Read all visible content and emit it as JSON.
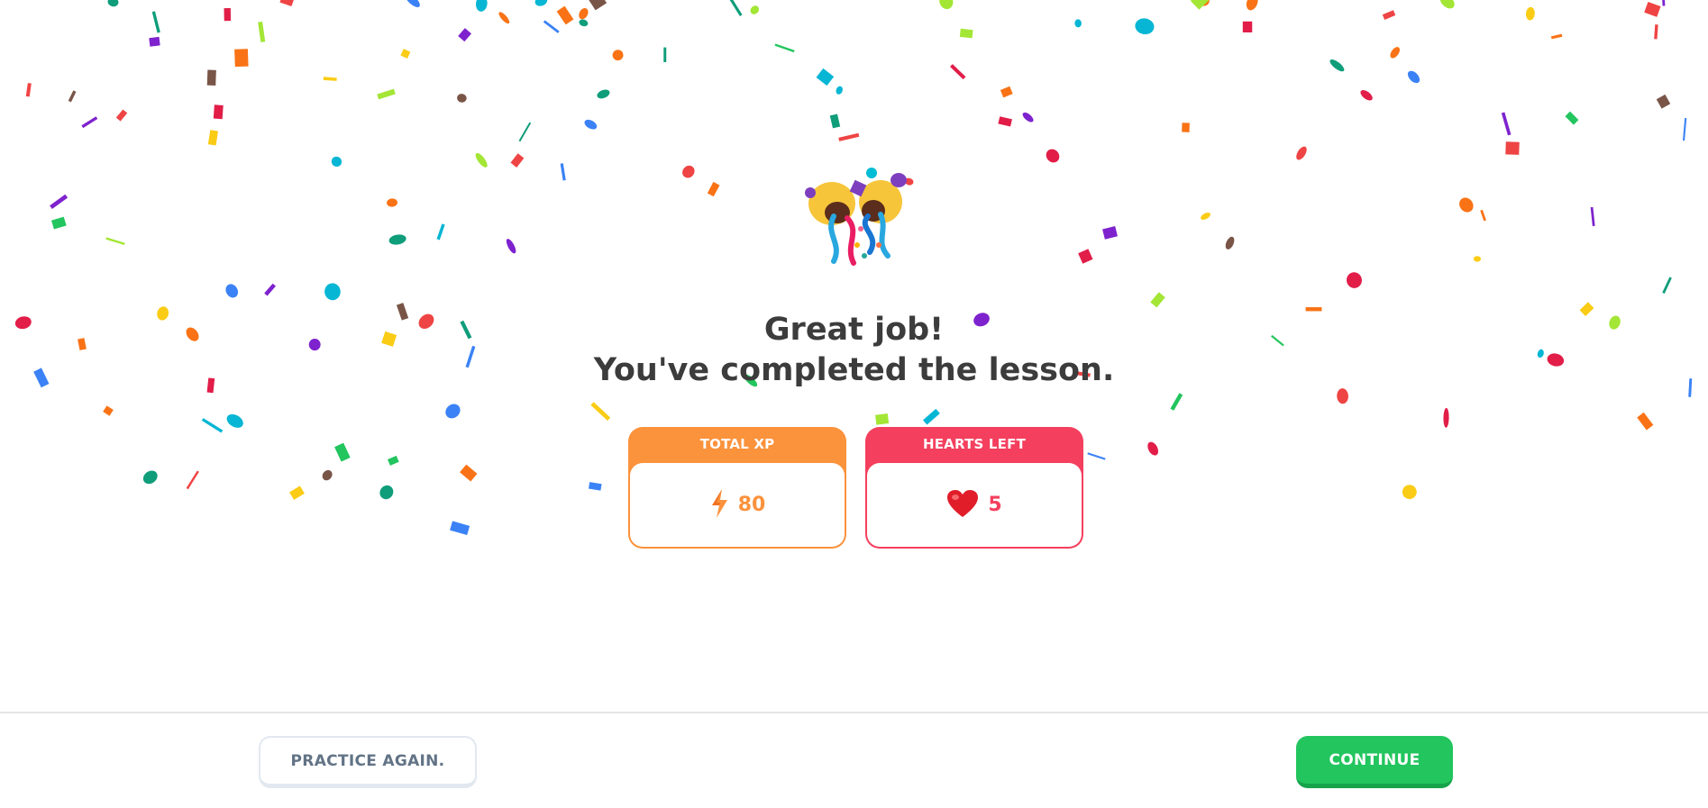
{
  "celebration": {
    "emoji_icon": "party-popper-icon",
    "headline_line1": "Great job!",
    "headline_line2": "You've completed the lesson."
  },
  "stats": {
    "xp": {
      "label": "TOTAL XP",
      "value": "80",
      "icon": "lightning-bolt-icon",
      "color": "#fb923c"
    },
    "hearts": {
      "label": "HEARTS LEFT",
      "value": "5",
      "icon": "heart-icon",
      "color": "#f43f5e"
    }
  },
  "footer": {
    "practice_label": "PRACTICE AGAIN.",
    "continue_label": "CONTINUE",
    "continue_color": "#22c55e"
  },
  "confetti_palette": [
    "#ef4444",
    "#f97316",
    "#facc15",
    "#a3e635",
    "#22c55e",
    "#06b6d4",
    "#3b82f6",
    "#7e22ce",
    "#e11d48",
    "#795548",
    "#0f9d7a"
  ]
}
